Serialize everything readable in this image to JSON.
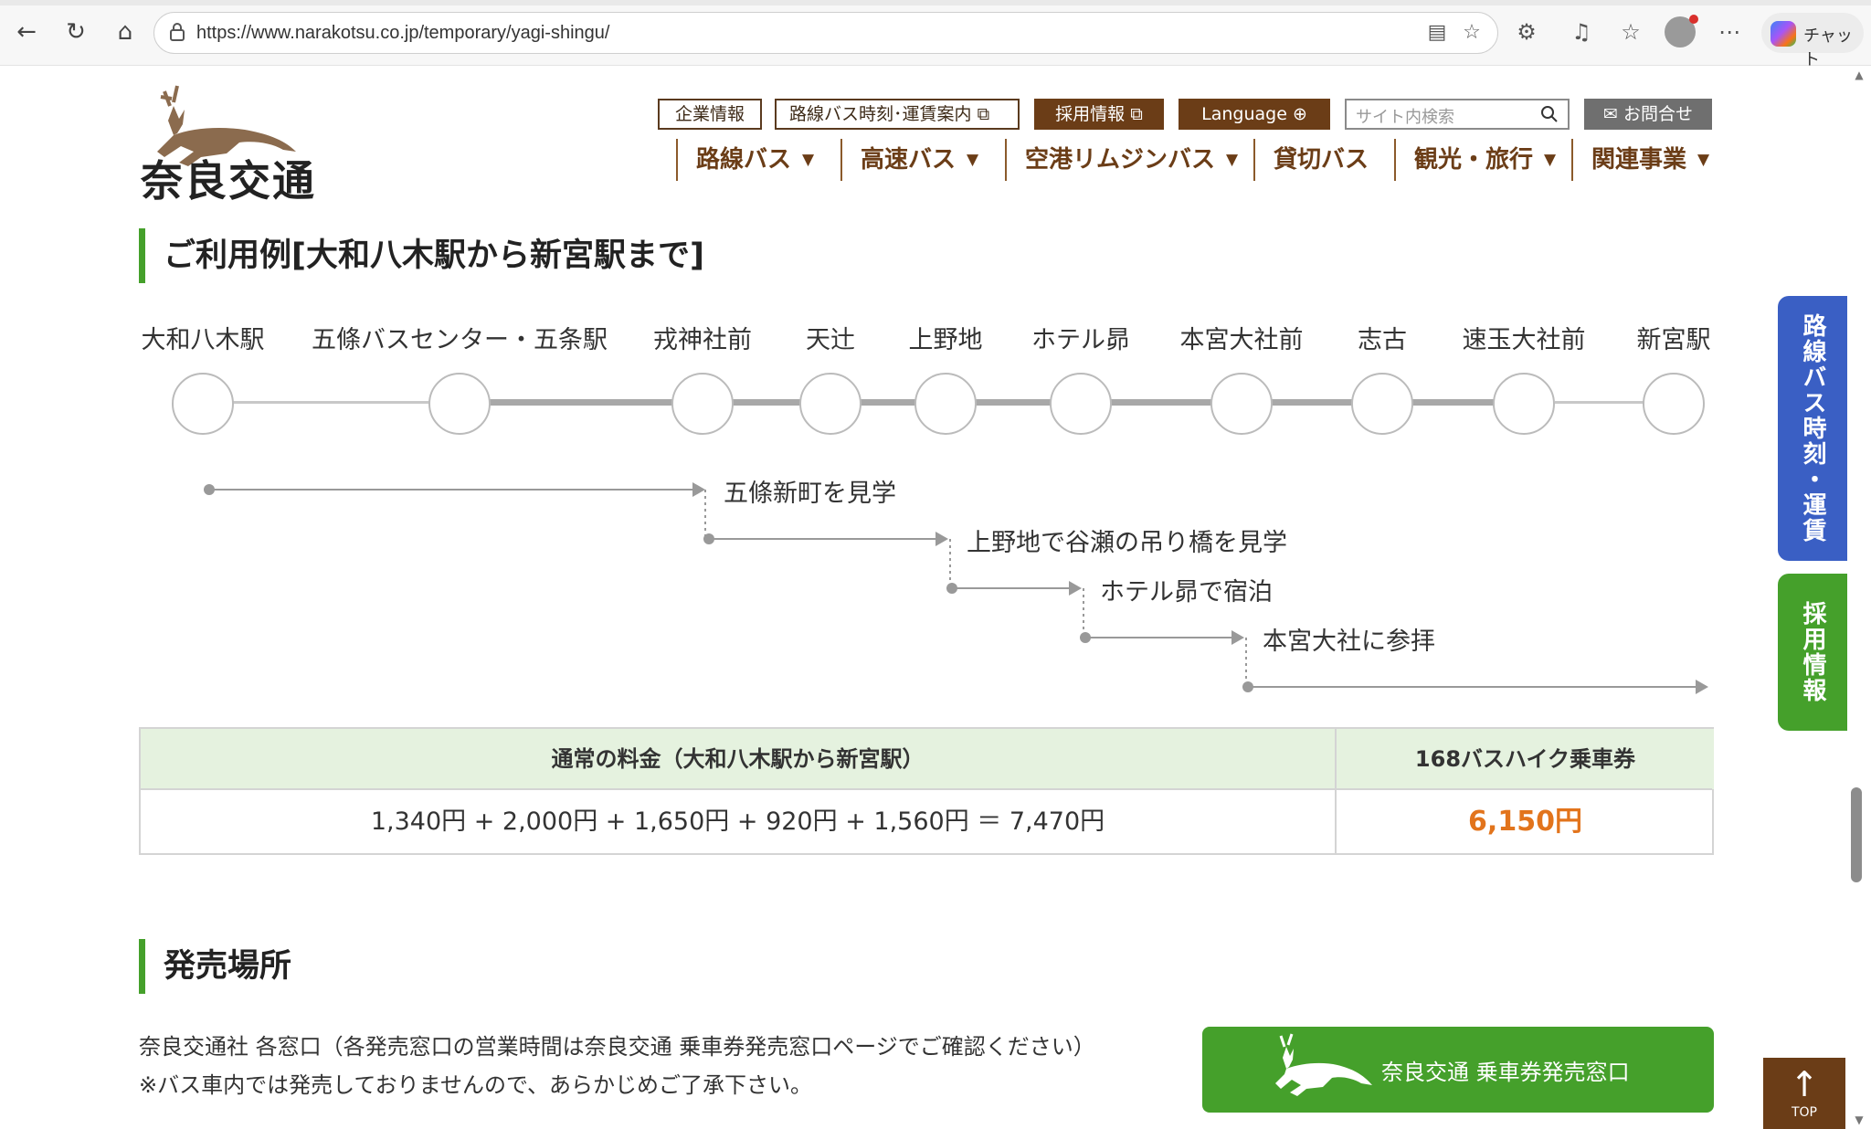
{
  "browser": {
    "url": "https://www.narakotsu.co.jp/temporary/yagi-shingu/",
    "copilot_label": "チャット"
  },
  "header": {
    "logo_text": "奈良交通",
    "links": {
      "corporate": "企業情報",
      "timetable": "路線バス時刻･運賃案内",
      "recruit": "採用情報",
      "language": "Language",
      "contact": "お問合せ"
    },
    "search_placeholder": "サイト内検索",
    "nav": [
      "路線バス",
      "高速バス",
      "空港リムジンバス",
      "貸切バス",
      "観光・旅行",
      "関連事業"
    ]
  },
  "example": {
    "title": "ご利用例[大和八木駅から新宮駅まで]",
    "stops": [
      "大和八木駅",
      "五條バスセンター・五条駅",
      "戎神社前",
      "天辻",
      "上野地",
      "ホテル昴",
      "本宮大社前",
      "志古",
      "速玉大社前",
      "新宮駅"
    ],
    "itinerary": [
      "五條新町を見学",
      "上野地で谷瀬の吊り橋を見学",
      "ホテル昴で宿泊",
      "本宮大社に参拝"
    ]
  },
  "fare": {
    "header_normal": "通常の料金（大和八木駅から新宮駅）",
    "header_pass": "168バスハイク乗車券",
    "normal_value": "1,340円 + 2,000円 + 1,650円 + 920円 + 1,560円 ＝ 7,470円",
    "pass_value": "6,150円"
  },
  "sales": {
    "title": "発売場所",
    "line1": "奈良交通社 各窓口（各発売窓口の営業時間は奈良交通 乗車券発売窓口ページでご確認ください）",
    "line2": "※バス車内では発売しておりませんので、あらかじめご了承下さい。",
    "button": "奈良交通 乗車券発売窓口"
  },
  "side": {
    "timetable_tab": "路線バス時刻・運賃",
    "recruit_tab": "採用情報",
    "top_label": "TOP"
  },
  "colors": {
    "brand_brown": "#6b3d17",
    "accent_green": "#45a02b",
    "side_blue": "#3a5fc4",
    "price_orange": "#e2741c"
  }
}
